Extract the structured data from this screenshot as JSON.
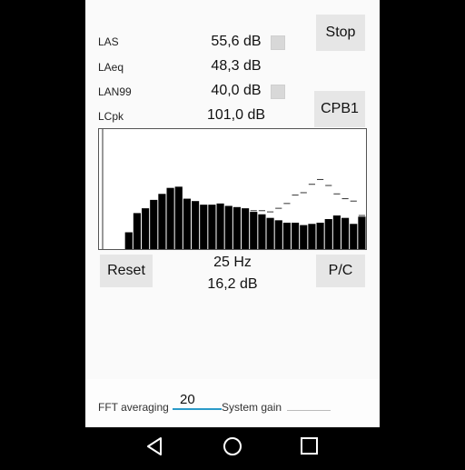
{
  "measurements": [
    {
      "label": "LAS",
      "value": "55,6 dB",
      "indicator": true
    },
    {
      "label": "LAeq",
      "value": "48,3 dB",
      "indicator": false
    },
    {
      "label": "LAN99",
      "value": "40,0 dB",
      "indicator": true
    },
    {
      "label": "LCpk",
      "value": "101,0 dB",
      "indicator": false
    }
  ],
  "buttons": {
    "stop": "Stop",
    "cpb": "CPB1",
    "reset": "Reset",
    "pc": "P/C"
  },
  "readout": {
    "frequency": "25 Hz",
    "level": "16,2 dB"
  },
  "settings": {
    "fft_label": "FFT averaging",
    "fft_value": "20",
    "gain_label": "System gain",
    "gain_value": ""
  },
  "chart_data": {
    "type": "bar",
    "ylim": [
      0,
      100
    ],
    "selected_index": 0,
    "values": [
      0,
      14,
      30,
      34,
      41,
      46,
      51,
      52,
      42,
      40,
      37,
      37,
      38,
      36,
      35,
      34,
      31,
      29,
      26,
      24,
      22,
      22,
      20,
      21,
      22,
      25,
      28,
      26,
      21,
      27
    ],
    "max_hold": [
      null,
      null,
      null,
      null,
      null,
      null,
      null,
      null,
      null,
      null,
      null,
      null,
      null,
      null,
      null,
      null,
      32,
      32,
      31,
      34,
      38,
      45,
      47,
      54,
      58,
      53,
      46,
      42,
      40,
      28
    ]
  },
  "navbar": {
    "back_icon": "back-triangle-icon",
    "home_icon": "home-circle-icon",
    "recents_icon": "recents-square-icon"
  }
}
